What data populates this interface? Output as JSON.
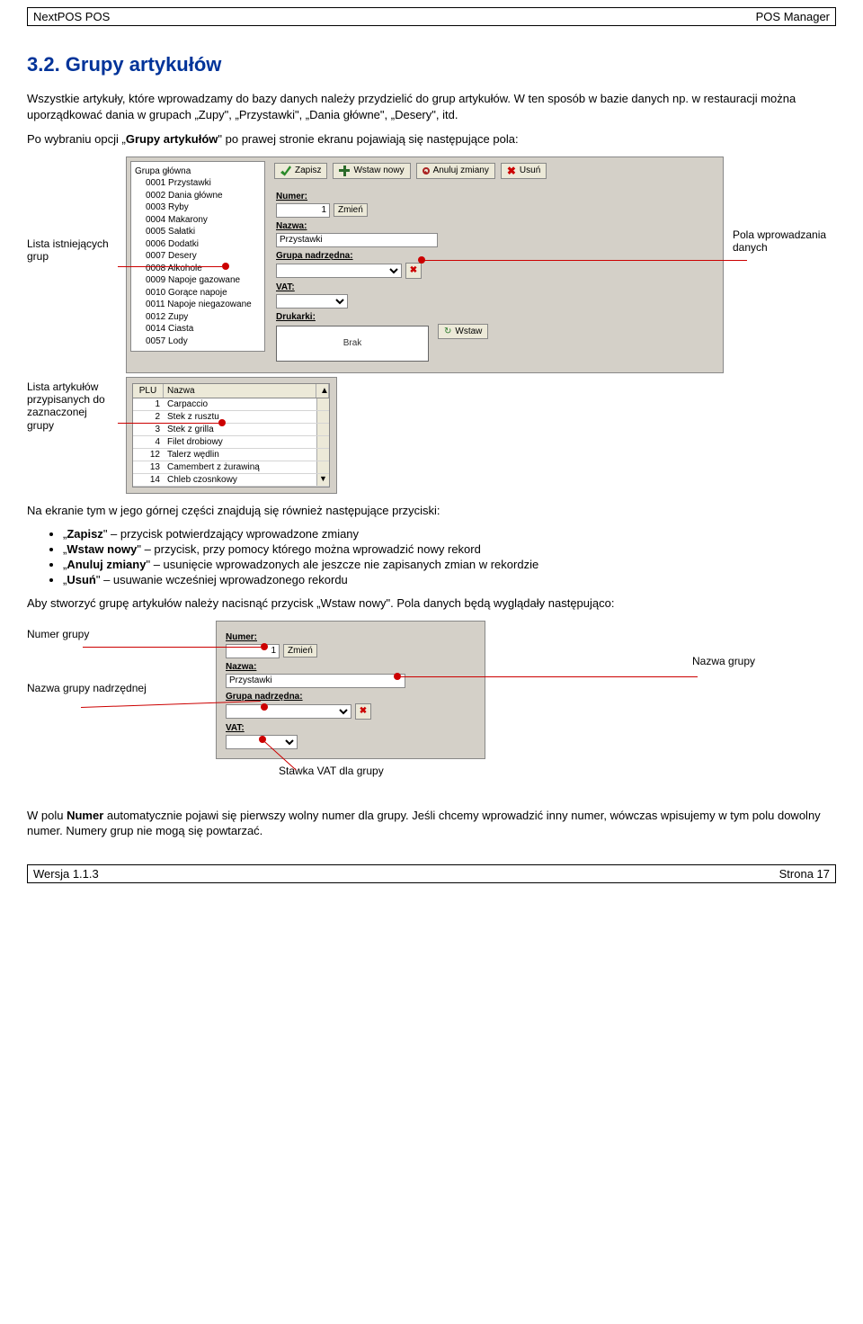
{
  "header": {
    "left": "NextPOS POS",
    "right": "POS Manager"
  },
  "footer": {
    "left": "Wersja 1.1.3",
    "right": "Strona 17"
  },
  "title": "3.2. Grupy artykułów",
  "intro_p1": "Wszystkie artykuły, które wprowadzamy do bazy danych należy przydzielić do grup artykułów. W ten sposób w bazie danych np. w restauracji można uporządkować dania w grupach „Zupy\", „Przystawki\", „Dania główne\", „Desery\", itd.",
  "intro_p2_a": "Po wybraniu opcji „",
  "intro_p2_b": "Grupy artykułów",
  "intro_p2_c": "\" po prawej stronie ekranu pojawiają się następujące pola:",
  "annotations": {
    "left1": "Lista istniejących grup",
    "right1": "Pola wprowadzania danych",
    "left2": "Lista artykułów przypisanych do zaznaczonej grupy",
    "numer_grupy": "Numer grupy",
    "nazwa_nadrz": "Nazwa grupy nadrzędnej",
    "nazwa_grupy": "Nazwa grupy",
    "stawka_vat": "Stawka VAT dla grupy"
  },
  "screenshot1": {
    "tree_root": "Grupa główna",
    "tree_items": [
      "0001 Przystawki",
      "0002 Dania główne",
      "0003 Ryby",
      "0004 Makarony",
      "0005 Sałatki",
      "0006 Dodatki",
      "0007 Desery",
      "0008 Alkohole",
      "0009 Napoje gazowane",
      "0010 Gorące napoje",
      "0011 Napoje niegazowane",
      "0012 Zupy",
      "0014 Ciasta",
      "0057 Lody"
    ],
    "toolbar": {
      "zapisz": "Zapisz",
      "wstaw": "Wstaw nowy",
      "anuluj": "Anuluj zmiany",
      "usun": "Usuń"
    },
    "form": {
      "numer_label": "Numer:",
      "numer_value": "1",
      "zmien_btn": "Zmień",
      "nazwa_label": "Nazwa:",
      "nazwa_value": "Przystawki",
      "grupa_label": "Grupa nadrzędna:",
      "vat_label": "VAT:",
      "drukarki_label": "Drukarki:",
      "brak": "Brak",
      "wstaw_btn": "Wstaw"
    },
    "grid_headers": {
      "plu": "PLU",
      "nazwa": "Nazwa"
    },
    "grid_rows": [
      {
        "plu": "1",
        "nazwa": "Carpaccio"
      },
      {
        "plu": "2",
        "nazwa": "Stek z rusztu"
      },
      {
        "plu": "3",
        "nazwa": "Stek z grilla"
      },
      {
        "plu": "4",
        "nazwa": "Filet drobiowy"
      },
      {
        "plu": "12",
        "nazwa": "Talerz wędlin"
      },
      {
        "plu": "13",
        "nazwa": "Camembert z żurawiną"
      },
      {
        "plu": "14",
        "nazwa": "Chleb czosnkowy"
      }
    ]
  },
  "mid_text": {
    "line1": "Na ekranie tym w jego górnej części znajdują się również następujące przyciski:",
    "bullets": {
      "b1a": "Zapisz",
      "b1b": "\" – przycisk potwierdzający wprowadzone zmiany",
      "b2a": "Wstaw nowy",
      "b2b": "\" – przycisk, przy pomocy którego można wprowadzić nowy rekord",
      "b3a": "Anuluj zmiany",
      "b3b": "\" – usunięcie wprowadzonych ale jeszcze nie zapisanych zmian w rekordzie",
      "b4a": "Usuń",
      "b4b": "\" – usuwanie wcześniej wprowadzonego rekordu",
      "q": "„"
    },
    "line2": "Aby stworzyć grupę artykułów należy nacisnąć przycisk „Wstaw nowy\". Pola danych będą wyglądały następująco:"
  },
  "screenshot2": {
    "numer_label": "Numer:",
    "numer_value": "1",
    "zmien_btn": "Zmień",
    "nazwa_label": "Nazwa:",
    "nazwa_value": "Przystawki",
    "grupa_label": "Grupa nadrzędna:",
    "vat_label": "VAT:"
  },
  "closing_a": "W polu ",
  "closing_b": "Numer",
  "closing_c": " automatycznie pojawi się pierwszy wolny numer dla grupy. Jeśli chcemy wprowadzić inny numer, wówczas wpisujemy w tym polu dowolny numer. Numery grup nie mogą się powtarzać."
}
